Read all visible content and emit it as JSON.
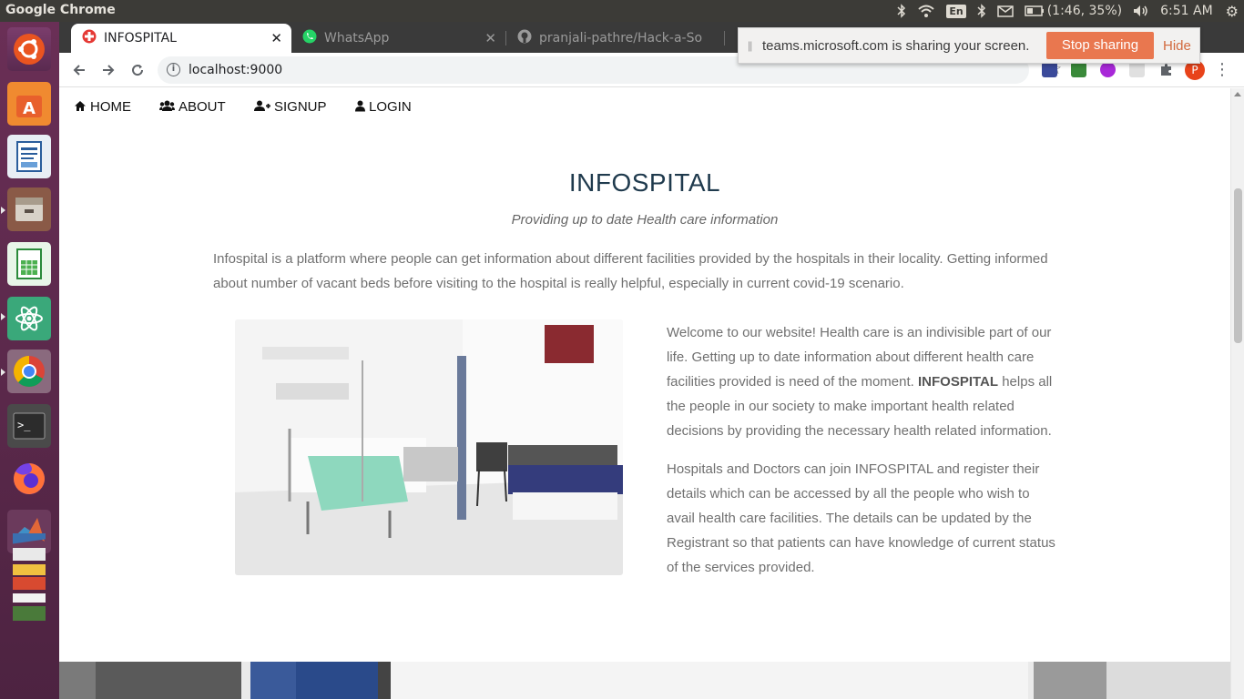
{
  "system_panel": {
    "app_name": "Google Chrome",
    "keyboard_layout": "En",
    "battery_text": "(1:46, 35%)",
    "clock": "6:51 AM"
  },
  "launcher": {
    "items": [
      "ubuntu-dash",
      "software-center",
      "libreoffice-writer",
      "files",
      "libreoffice-calc",
      "atom",
      "chrome",
      "terminal",
      "firefox",
      "matlab",
      "workspaces",
      "app-stack",
      "trash"
    ]
  },
  "browser": {
    "tabs": [
      {
        "title": "INFOSPITAL",
        "active": true
      },
      {
        "title": "WhatsApp",
        "active": false
      },
      {
        "title": "pranjali-pathre/Hack-a-So",
        "active": false
      }
    ],
    "url": "localhost:9000",
    "profile_initial": "P"
  },
  "share_bar": {
    "message": "teams.microsoft.com is sharing your screen.",
    "stop_label": "Stop sharing",
    "hide_label": "Hide"
  },
  "site": {
    "nav": [
      {
        "label": "HOME",
        "icon": "home-icon"
      },
      {
        "label": "ABOUT",
        "icon": "users-icon"
      },
      {
        "label": "SIGNUP",
        "icon": "user-plus-icon"
      },
      {
        "label": "LOGIN",
        "icon": "user-icon"
      }
    ],
    "title": "INFOSPITAL",
    "subtitle": "Providing up to date Health care information",
    "intro": "Infospital is a platform where people can get information about different facilities provided by the hospitals in their locality. Getting informed about number of vacant beds before visiting to the hospital is really helpful, especially in current covid-19 scenario.",
    "welcome_before": "Welcome to our website! Health care is an indivisible part of our life. Getting up to date information about different health care facilities provided is need of the moment.",
    "welcome_bold": "INFOSPITAL",
    "welcome_after": "helps all the people in our society to make important health related decisions by providing the necessary health related information.",
    "hospitals_paragraph": "Hospitals and Doctors can join INFOSPITAL and register their details which can be accessed by all the people who wish to avail health care facilities. The details can be updated by the Registrant so that patients can have knowledge of current status of the services provided.",
    "image_subject": "hospital-room-photo"
  },
  "colors": {
    "launcher_bg": "#5c2a4c",
    "title_color": "#1f3a4d",
    "body_text": "#707070",
    "stop_button": "#e9774f",
    "avatar": "#e8431a"
  }
}
